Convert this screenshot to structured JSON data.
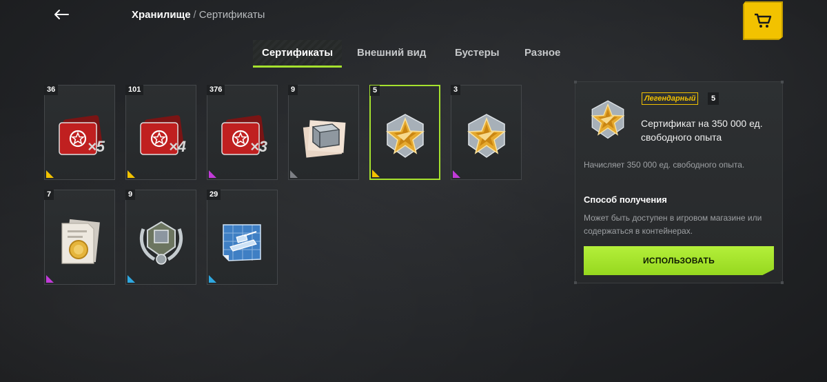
{
  "header": {
    "breadcrumb_root": "Хранилище",
    "breadcrumb_separator": "/",
    "breadcrumb_current": "Сертификаты"
  },
  "tabs": [
    {
      "label": "Сертификаты",
      "active": true
    },
    {
      "label": "Внешний вид",
      "active": false
    },
    {
      "label": "Бустеры",
      "active": false
    },
    {
      "label": "Разное",
      "active": false
    }
  ],
  "items": [
    {
      "count": "36",
      "icon": "red-certificate-stack-x5-icon",
      "multiplier": "×5",
      "rarity_color": "#f2c200"
    },
    {
      "count": "101",
      "icon": "red-certificate-stack-x4-icon",
      "multiplier": "×4",
      "rarity_color": "#f2c200"
    },
    {
      "count": "376",
      "icon": "red-certificate-stack-x3-icon",
      "multiplier": "×3",
      "rarity_color": "#c13bd8"
    },
    {
      "count": "9",
      "icon": "container-blueprint-icon",
      "multiplier": "",
      "rarity_color": "#7d8085"
    },
    {
      "count": "5",
      "icon": "gold-star-medal-icon",
      "multiplier": "",
      "rarity_color": "#f2c200",
      "selected": true
    },
    {
      "count": "3",
      "icon": "gold-star-medal-icon",
      "multiplier": "",
      "rarity_color": "#c13bd8"
    },
    {
      "count": "7",
      "icon": "coin-document-icon",
      "multiplier": "",
      "rarity_color": "#c13bd8"
    },
    {
      "count": "9",
      "icon": "laurel-emblem-icon",
      "multiplier": "",
      "rarity_color": "#2fa8e0"
    },
    {
      "count": "29",
      "icon": "tank-blueprint-icon",
      "multiplier": "",
      "rarity_color": "#2fa8e0"
    }
  ],
  "detail": {
    "rarity": "Легендарный",
    "quantity": "5",
    "title": "Сертификат на 350 000 ед. свободного опыта",
    "description": "Начисляет 350 000 ед. свободного опыта.",
    "howto_heading": "Способ получения",
    "howto_text": "Может быть доступен в игровом магазине или содержаться в контейнерах.",
    "use_button": "ИСПОЛЬЗОВАТЬ"
  },
  "colors": {
    "accent_green": "#a6e22e",
    "legendary_gold": "#f2c200",
    "epic_purple": "#c13bd8",
    "rare_blue": "#2fa8e0",
    "common_grey": "#7d8085"
  }
}
